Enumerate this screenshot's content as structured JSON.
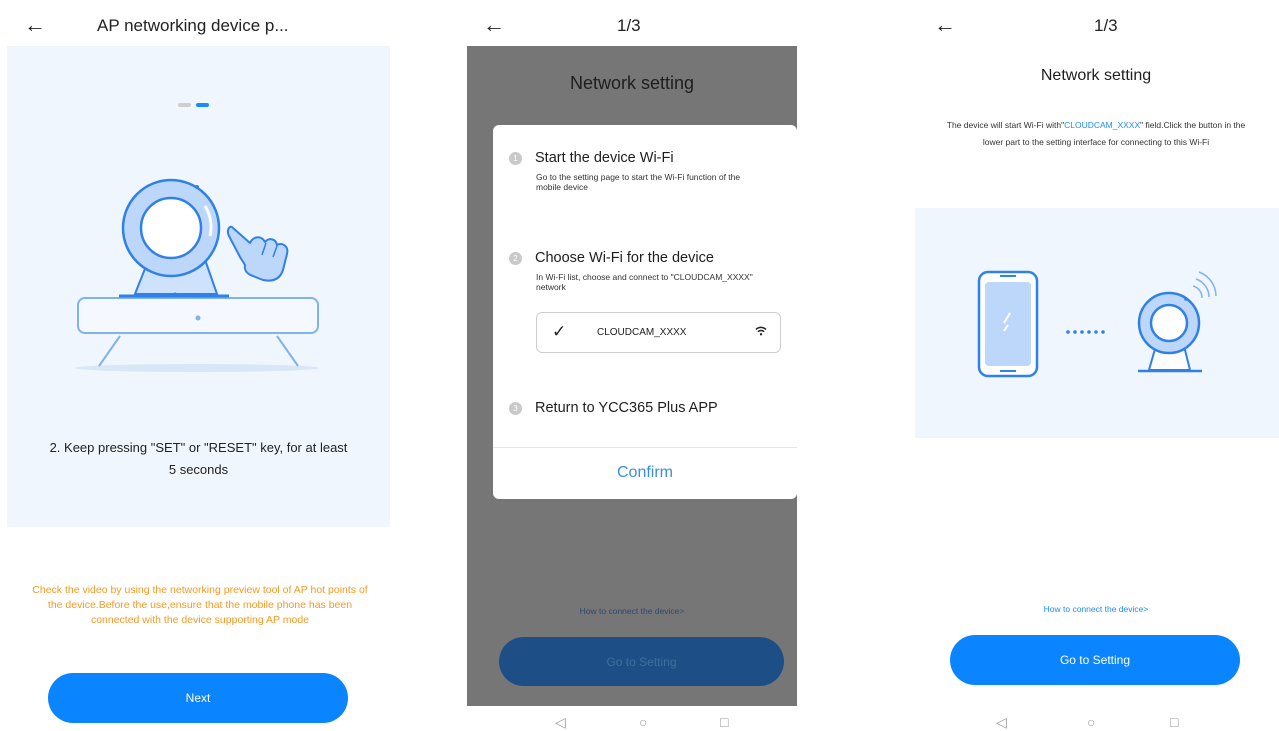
{
  "screens": {
    "ap_instructions": {
      "title": "AP networking device p...",
      "back_icon": "←",
      "step_text": "2. Keep pressing \"SET\" or \"RESET\" key, for at least 5 seconds",
      "notice": "Check the video by using the networking preview tool of AP hot points of the device.Before the use,ensure that the mobile phone has been connected with the device supporting AP mode",
      "next_button": "Next"
    },
    "network_dialog": {
      "title": "1/3",
      "back_icon": "←",
      "heading": "Network setting",
      "steps": [
        {
          "num": "1",
          "title": "Start the device Wi-Fi",
          "desc": "Go to the setting page to start the Wi-Fi function of the mobile device"
        },
        {
          "num": "2",
          "title": "Choose Wi-Fi for the device",
          "desc": "In Wi-Fi list, choose and connect to \"CLOUDCAM_XXXX\" network"
        },
        {
          "num": "3",
          "title": "Return to YCC365 Plus APP",
          "desc": ""
        }
      ],
      "wifi_item": {
        "check": "✓",
        "ssid": "CLOUDCAM_XXXX"
      },
      "confirm": "Confirm",
      "howto": "How to connect the device>",
      "goto_button": "Go to Setting",
      "nav": {
        "back": "◁",
        "home": "○",
        "recent": "□"
      }
    },
    "network_setting": {
      "title": "1/3",
      "back_icon": "←",
      "heading": "Network setting",
      "desc_prefix": "The device will start Wi-Fi with\"",
      "desc_highlight": "CLOUDCAM_XXXX",
      "desc_suffix": "\" field.Click the button in the lower part to the setting interface for connecting to this Wi-Fi",
      "howto": "How to connect the device>",
      "goto_button": "Go to Setting",
      "nav": {
        "back": "◁",
        "home": "○",
        "recent": "□"
      }
    }
  },
  "colors": {
    "primary_button": "#0a84ff",
    "notice_orange": "#f59a23",
    "link_blue": "#1a8cff",
    "illustration_bg": "#f0f6fe",
    "overlay_gray": "#767676"
  },
  "icons": [
    "back-arrow-icon",
    "camera-illustration",
    "hand-pointer-icon",
    "wifi-icon",
    "phone-illustration",
    "nav-back-icon",
    "nav-home-icon",
    "nav-recent-icon"
  ]
}
